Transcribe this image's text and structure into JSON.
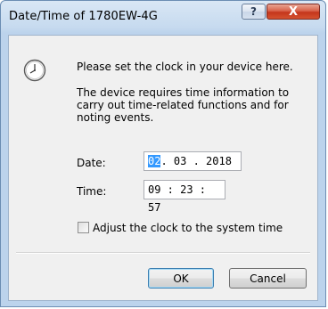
{
  "window": {
    "title": "Date/Time of 1780EW-4G",
    "help_glyph": "?",
    "close_glyph": "X"
  },
  "content": {
    "intro": "Please set the clock in your device here.",
    "description": "The device requires time information to carry out time-related functions and for noting events."
  },
  "fields": {
    "date_label": "Date:",
    "date_selected": "02",
    "date_rest": ". 03 . 2018",
    "time_label": "Time:",
    "time_value": "09 : 23 : 57"
  },
  "checkbox": {
    "label": "Adjust the clock to the system time",
    "checked": false
  },
  "buttons": {
    "ok": "OK",
    "cancel": "Cancel"
  },
  "icons": {
    "dialog_icon": "clock-icon"
  },
  "colors": {
    "selection": "#3399ff",
    "close_button": "#c5361c"
  }
}
